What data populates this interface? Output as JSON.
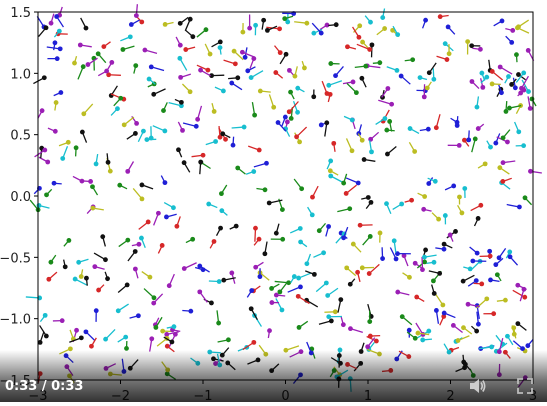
{
  "player": {
    "time_display": "0:33 / 0:33",
    "progress_fraction": 1.0,
    "volume_icon": "volume-icon",
    "fullscreen_icon": "fullscreen-icon"
  },
  "chart_data": {
    "type": "scatter",
    "title": "",
    "xlabel": "",
    "ylabel": "",
    "xlim": [
      -3,
      3
    ],
    "ylim": [
      -1.5,
      1.5
    ],
    "xticks": [
      -3,
      -2,
      -1,
      0,
      1,
      2,
      3
    ],
    "xtick_labels": [
      "−3",
      "−2",
      "−1",
      "0",
      "1",
      "2",
      "3"
    ],
    "yticks": [
      -1.5,
      -1.0,
      -0.5,
      0.0,
      0.5,
      1.0,
      1.5
    ],
    "ytick_labels": [
      "−1.5",
      "−1.0",
      "−0.5",
      "0.0",
      "0.5",
      "1.0",
      "1.5"
    ],
    "grid": false,
    "marker": "dot-with-tail",
    "colors": [
      "#1f1fd6",
      "#d62728",
      "#1a8a1a",
      "#17becf",
      "#bcbd22",
      "#9b1fb5",
      "#111111"
    ],
    "particles_shown": 560
  }
}
